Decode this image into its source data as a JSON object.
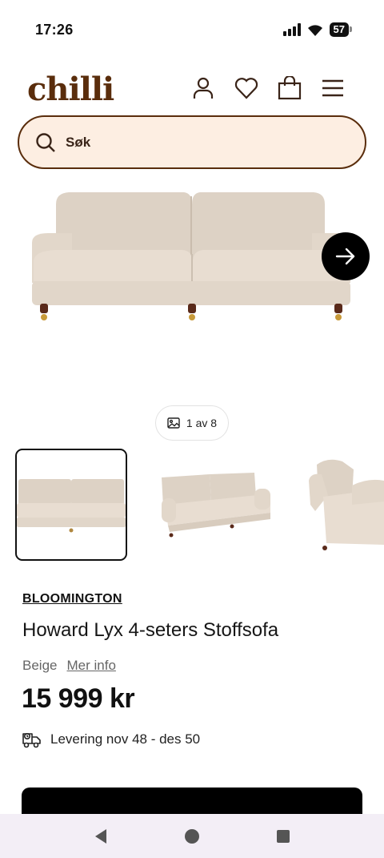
{
  "status_bar": {
    "time": "17:26",
    "battery": "57"
  },
  "header": {
    "logo": "chilli",
    "icons": [
      "user-icon",
      "heart-icon",
      "bag-icon",
      "menu-icon"
    ]
  },
  "search": {
    "placeholder": "Søk"
  },
  "gallery": {
    "counter": "1 av 8",
    "thumbnail_count": 3
  },
  "product": {
    "brand": "BLOOMINGTON",
    "title": "Howard Lyx 4-seters Stoffsofa",
    "color": "Beige",
    "more_info": "Mer info",
    "price": "15 999 kr",
    "delivery": "Levering nov 48 - des 50"
  },
  "colors": {
    "brand": "#5a2d0c",
    "search_bg": "#fdeee2",
    "sofa": "#e4d9cd"
  }
}
